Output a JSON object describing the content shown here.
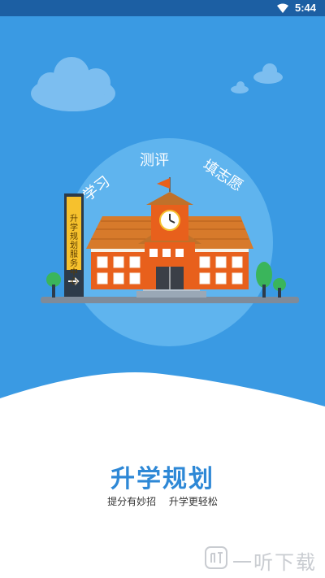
{
  "status_bar": {
    "time": "5:44",
    "wifi_icon": "wifi-icon"
  },
  "hero": {
    "arc_labels": [
      "学习",
      "测评",
      "填志愿"
    ],
    "sign_text": "升学规划服务中心",
    "colors": {
      "sky": "#3a9ae3",
      "circle": "#5fb4ee",
      "building": "#e8601c",
      "roof": "#c0712a"
    }
  },
  "app": {
    "title": "升学规划",
    "slogan": [
      "提分有妙招",
      "升学更轻松"
    ]
  },
  "watermark": {
    "text": "一听下载",
    "icon": "yiting-logo-icon"
  }
}
